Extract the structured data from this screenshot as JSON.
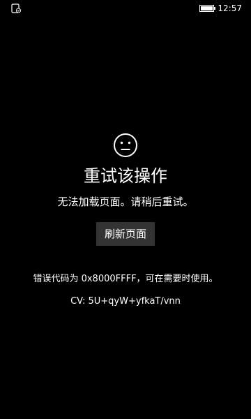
{
  "status_bar": {
    "left_icon": "app-status-icon",
    "battery_icon": "battery-icon",
    "time": "12:57"
  },
  "error_page": {
    "icon": "sad-face-icon",
    "title": "重试该操作",
    "message": "无法加载页面。请稍后重试。",
    "refresh_label": "刷新页面",
    "error_code_text": "错误代码为 0x8000FFFF，可在需要时使用。",
    "cv_text": "CV: 5U+qyW+yfkaT/vnn"
  },
  "colors": {
    "background": "#000000",
    "text": "#ffffff",
    "button": "#333333"
  }
}
